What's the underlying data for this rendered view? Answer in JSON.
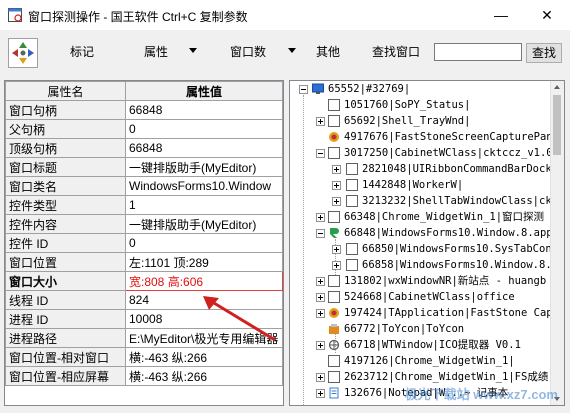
{
  "window": {
    "title": "窗口探测操作 - 国王软件 Ctrl+C 复制参数",
    "minimize": "—",
    "close": "✕"
  },
  "toolbar": {
    "mark": "标记",
    "attribute": "属性",
    "window_count": "窗口数",
    "other": "其他",
    "find_window": "查找窗口",
    "search_value": "",
    "search_button": "查找"
  },
  "grid": {
    "header_key": "属性名",
    "header_value": "属性值",
    "rows": [
      {
        "key": "窗口句柄",
        "value": "66848"
      },
      {
        "key": "父句柄",
        "value": "0"
      },
      {
        "key": "顶级句柄",
        "value": "66848"
      },
      {
        "key": "窗口标题",
        "value": "一键排版助手(MyEditor)"
      },
      {
        "key": "窗口类名",
        "value": "WindowsForms10.Window"
      },
      {
        "key": "控件类型",
        "value": "1"
      },
      {
        "key": "控件内容",
        "value": "一键排版助手(MyEditor)"
      },
      {
        "key": "控件 ID",
        "value": "0"
      },
      {
        "key": "窗口位置",
        "value": "左:1101 顶:289"
      },
      {
        "key": "窗口大小",
        "value": "宽:808 高:606"
      },
      {
        "key": "线程 ID",
        "value": "824"
      },
      {
        "key": "进程 ID",
        "value": "10008"
      },
      {
        "key": "进程路径",
        "value": "E:\\MyEditor\\极光专用编辑器"
      },
      {
        "key": "窗口位置-相对窗口",
        "value": "横:-463 纵:266"
      },
      {
        "key": "窗口位置-相应屏幕",
        "value": "横:-463 纵:266"
      }
    ]
  },
  "tree": {
    "nodes": [
      {
        "text": "65552|#32769|",
        "icon": "monitor-icon"
      },
      {
        "text": "1051760|SoPY_Status|",
        "icon": "window-icon"
      },
      {
        "text": "65692|Shell_TrayWnd|",
        "icon": "window-icon"
      },
      {
        "text": "4917676|FastStoneScreenCapturePan",
        "icon": "faststone-icon"
      },
      {
        "text": "3017250|CabinetWClass|cktccz_v1.0",
        "icon": "window-icon"
      },
      {
        "text": "2821048|UIRibbonCommandBarDock",
        "icon": "window-icon"
      },
      {
        "text": "1442848|WorkerW|",
        "icon": "window-icon"
      },
      {
        "text": "3213232|ShellTabWindowClass|ck",
        "icon": "window-icon"
      },
      {
        "text": "66348|Chrome_WidgetWin_1|窗口探测",
        "icon": "window-icon"
      },
      {
        "text": "66848|WindowsForms10.Window.8.app",
        "icon": "myeditor-icon"
      },
      {
        "text": "66850|WindowsForms10.SysTabCon",
        "icon": "window-icon"
      },
      {
        "text": "66858|WindowsForms10.Window.8.",
        "icon": "window-icon"
      },
      {
        "text": "131802|wxWindowNR|新站点 - huangb",
        "icon": "window-icon"
      },
      {
        "text": "524668|CabinetWClass|office",
        "icon": "window-icon"
      },
      {
        "text": "197424|TApplication|FastStone Cap",
        "icon": "faststone-icon"
      },
      {
        "text": "66772|ToYcon|ToYcon",
        "icon": "toycon-icon"
      },
      {
        "text": "66718|WTWindow|ICO提取器 V0.1",
        "icon": "ico-extractor-icon"
      },
      {
        "text": "4197126|Chrome_WidgetWin_1|",
        "icon": "window-icon"
      },
      {
        "text": "2623712|Chrome_WidgetWin_1|FS成绩",
        "icon": "window-icon"
      },
      {
        "text": "132676|Notepad|W...~ 记事本",
        "icon": "notepad-icon"
      }
    ]
  },
  "watermark": "极光下载站 www.xz7.com",
  "colors": {
    "toolbar_bg": "#f0f0f0",
    "selected_border": "#e04040",
    "selected_text": "#e01010",
    "arrow": "#d02020"
  }
}
